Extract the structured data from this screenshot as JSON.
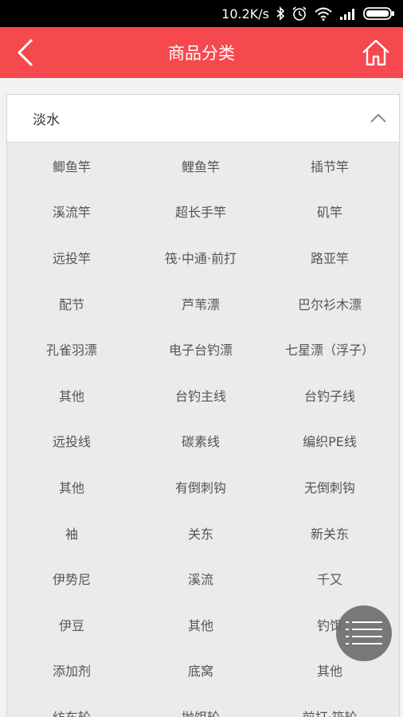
{
  "status": {
    "speed": "10.2K/s"
  },
  "header": {
    "title": "商品分类"
  },
  "panel": {
    "label": "淡水"
  },
  "items": [
    "鲫鱼竿",
    "鲤鱼竿",
    "插节竿",
    "溪流竿",
    "超长手竿",
    "矶竿",
    "远投竿",
    "筏·中通·前打",
    "路亚竿",
    "配节",
    "芦苇漂",
    "巴尔衫木漂",
    "孔雀羽漂",
    "电子台钓漂",
    "七星漂（浮子）",
    "其他",
    "台钓主线",
    "台钓子线",
    "远投线",
    "碳素线",
    "编织PE线",
    "其他",
    "有倒刺钩",
    "无倒刺钩",
    "袖",
    "关东",
    "新关东",
    "伊势尼",
    "溪流",
    "千又",
    "伊豆",
    "其他",
    "钓饵",
    "添加剂",
    "底窝",
    "其他",
    "纺车轮",
    "抛饵轮",
    "前打·筏轮"
  ],
  "colors": {
    "accent": "#f5494e",
    "statusbar": "#000000",
    "panel_bg": "#ebebeb"
  },
  "icons": {
    "back": "chevron-left-icon",
    "home": "home-icon",
    "collapse": "chevron-up-icon",
    "menu": "list-menu-icon"
  }
}
